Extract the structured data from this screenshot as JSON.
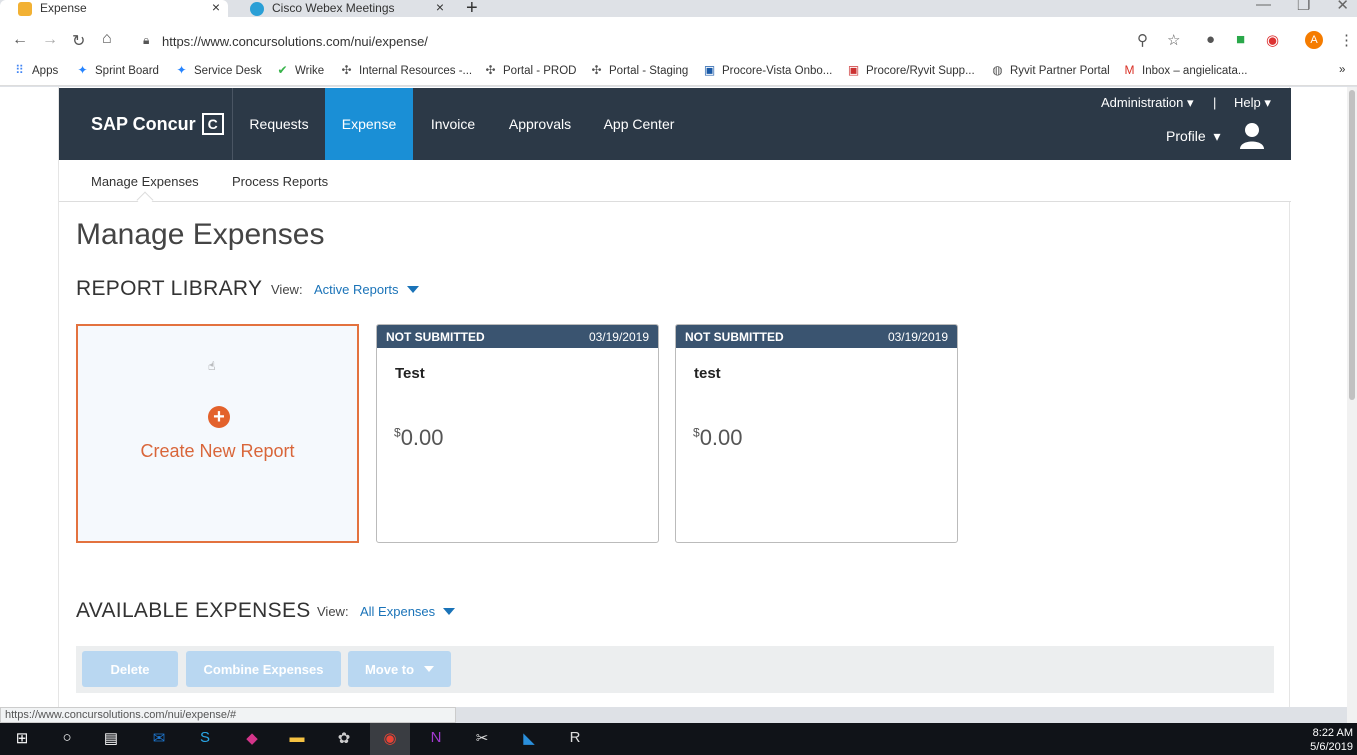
{
  "browser": {
    "tabs": [
      {
        "title": "Expense",
        "active": true,
        "favicon_color": "#f2b134"
      },
      {
        "title": "Cisco Webex Meetings",
        "active": false,
        "favicon_color": "#2a9fd6"
      }
    ],
    "new_tab_icon": "+",
    "close_icon": "×",
    "url": "https://www.concursolutions.com/nui/expense/",
    "bookmarks": [
      {
        "label": "Apps",
        "icon": "apps-grid-icon"
      },
      {
        "label": "Sprint Board",
        "icon": "jira-icon"
      },
      {
        "label": "Service Desk",
        "icon": "jira-icon"
      },
      {
        "label": "Wrike",
        "icon": "wrike-check-icon"
      },
      {
        "label": "Internal Resources -...",
        "icon": "slack-icon"
      },
      {
        "label": "Portal - PROD",
        "icon": "slack-icon"
      },
      {
        "label": "Portal - Staging",
        "icon": "slack-icon"
      },
      {
        "label": "Procore-Vista Onbo...",
        "icon": "procore-icon"
      },
      {
        "label": "Procore/Ryvit Supp...",
        "icon": "procore-icon"
      },
      {
        "label": "Ryvit Partner Portal",
        "icon": "globe-icon"
      },
      {
        "label": "Inbox – angielicata...",
        "icon": "gmail-icon"
      }
    ],
    "more_bookmarks": "»",
    "profile_initial": "A"
  },
  "concur": {
    "logo_text": "SAP Concur",
    "logo_mark": "C",
    "nav": [
      "Requests",
      "Expense",
      "Invoice",
      "Approvals",
      "App Center"
    ],
    "active_nav": "Expense",
    "admin_label": "Administration",
    "separator": "|",
    "help_label": "Help",
    "profile_label": "Profile",
    "subnav": [
      "Manage Expenses",
      "Process Reports"
    ],
    "colors": {
      "header_bg": "#2c3947",
      "active_nav": "#1a8fd6",
      "create_accent": "#e3622c",
      "card_header": "#3a5470",
      "link": "#1a73b8"
    }
  },
  "page": {
    "title": "Manage Expenses",
    "report_library": {
      "title": "REPORT LIBRARY",
      "view_label": "View:",
      "view_value": "Active Reports",
      "create_label": "Create New Report",
      "reports": [
        {
          "status": "NOT SUBMITTED",
          "date": "03/19/2019",
          "name": "Test",
          "currency": "$",
          "amount": "0.00"
        },
        {
          "status": "NOT SUBMITTED",
          "date": "03/19/2019",
          "name": "test",
          "currency": "$",
          "amount": "0.00"
        }
      ]
    },
    "available_expenses": {
      "title": "AVAILABLE EXPENSES",
      "view_label": "View:",
      "view_value": "All Expenses",
      "actions": {
        "delete": "Delete",
        "combine": "Combine Expenses",
        "move_to": "Move to"
      }
    }
  },
  "status_url": "https://www.concursolutions.com/nui/expense/#",
  "taskbar": {
    "time": "8:22 AM",
    "date": "5/6/2019"
  }
}
